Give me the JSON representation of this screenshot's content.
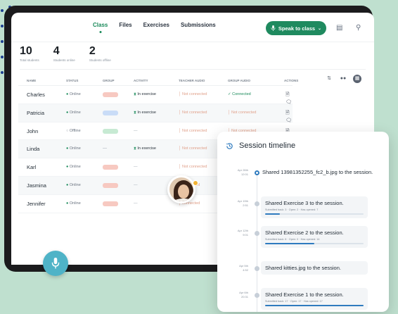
{
  "nav": {
    "tabs": [
      {
        "label": "Class",
        "active": true
      },
      {
        "label": "Files",
        "active": false
      },
      {
        "label": "Exercises",
        "active": false
      },
      {
        "label": "Submissions",
        "active": false
      }
    ],
    "speak_button": "Speak to class",
    "icons": [
      "chat-icon",
      "user-icon"
    ]
  },
  "stats": [
    {
      "value": "10",
      "label": "Total students"
    },
    {
      "value": "4",
      "label": "Students online"
    },
    {
      "value": "2",
      "label": "Students offline"
    }
  ],
  "table": {
    "headers": [
      "NAME",
      "STATUS",
      "GROUP",
      "ACTIVITY",
      "TEACHER AUDIO",
      "GROUP AUDIO",
      "ACTIONS"
    ],
    "rows": [
      {
        "name": "Charles",
        "status": "Online",
        "group": "red",
        "activity": "In exercise",
        "teacher_audio": "Not connected",
        "group_audio": "Connected",
        "group_audio_ok": true
      },
      {
        "name": "Patricia",
        "status": "Online",
        "group": "blue",
        "activity": "In exercise",
        "teacher_audio": "Not connected",
        "group_audio": "Not connected",
        "group_audio_ok": false
      },
      {
        "name": "John",
        "status": "Offline",
        "group": "green",
        "activity": "—",
        "teacher_audio": "Not connected",
        "group_audio": "Not connected",
        "group_audio_ok": false
      },
      {
        "name": "Linda",
        "status": "Online",
        "group": "",
        "activity": "In exercise",
        "teacher_audio": "Not connected",
        "group_audio": "",
        "group_audio_ok": false
      },
      {
        "name": "Karl",
        "status": "Online",
        "group": "red",
        "activity": "—",
        "teacher_audio": "Not connected",
        "group_audio": "",
        "group_audio_ok": false
      },
      {
        "name": "Jasmina",
        "status": "Online",
        "group": "red",
        "activity": "—",
        "teacher_audio": "connected",
        "group_audio": "",
        "group_audio_ok": false
      },
      {
        "name": "Jennifer",
        "status": "Online",
        "group": "red",
        "activity": "—",
        "teacher_audio": "connected",
        "group_audio": "",
        "group_audio_ok": false
      }
    ]
  },
  "timeline": {
    "title": "Session timeline",
    "items": [
      {
        "date": "Apr 26th\n12:01",
        "text": "Shared 13981352255_fc2_b.jpg to the session.",
        "sub": "",
        "progress": null
      },
      {
        "date": "Apr 19th\n2:51",
        "text": "Shared Exercise 3 to the session.",
        "sub": "Submitted back: 3 · Open: 2 · Has opened: 7",
        "progress": 0.15
      },
      {
        "date": "Apr 12th\n9:01",
        "text": "Shared Exercise 2 to the session.",
        "sub": "Submitted back: 8 · Open: 0 · Has opened: 14",
        "progress": 0.5
      },
      {
        "date": "Apr 5th\n4:52",
        "text": "Shared kitties.jpg to the session.",
        "sub": "",
        "progress": null
      },
      {
        "date": "Apr 6th\n20:31",
        "text": "Shared Exercise 1 to the session.",
        "sub": "Submitted back: 17 · Open: 17 · Has opened: 17",
        "progress": 1.0
      }
    ]
  },
  "colors": {
    "accent": "#1f8a5f",
    "timeline_accent": "#2f7bbf",
    "background": "#bfe0cf"
  }
}
